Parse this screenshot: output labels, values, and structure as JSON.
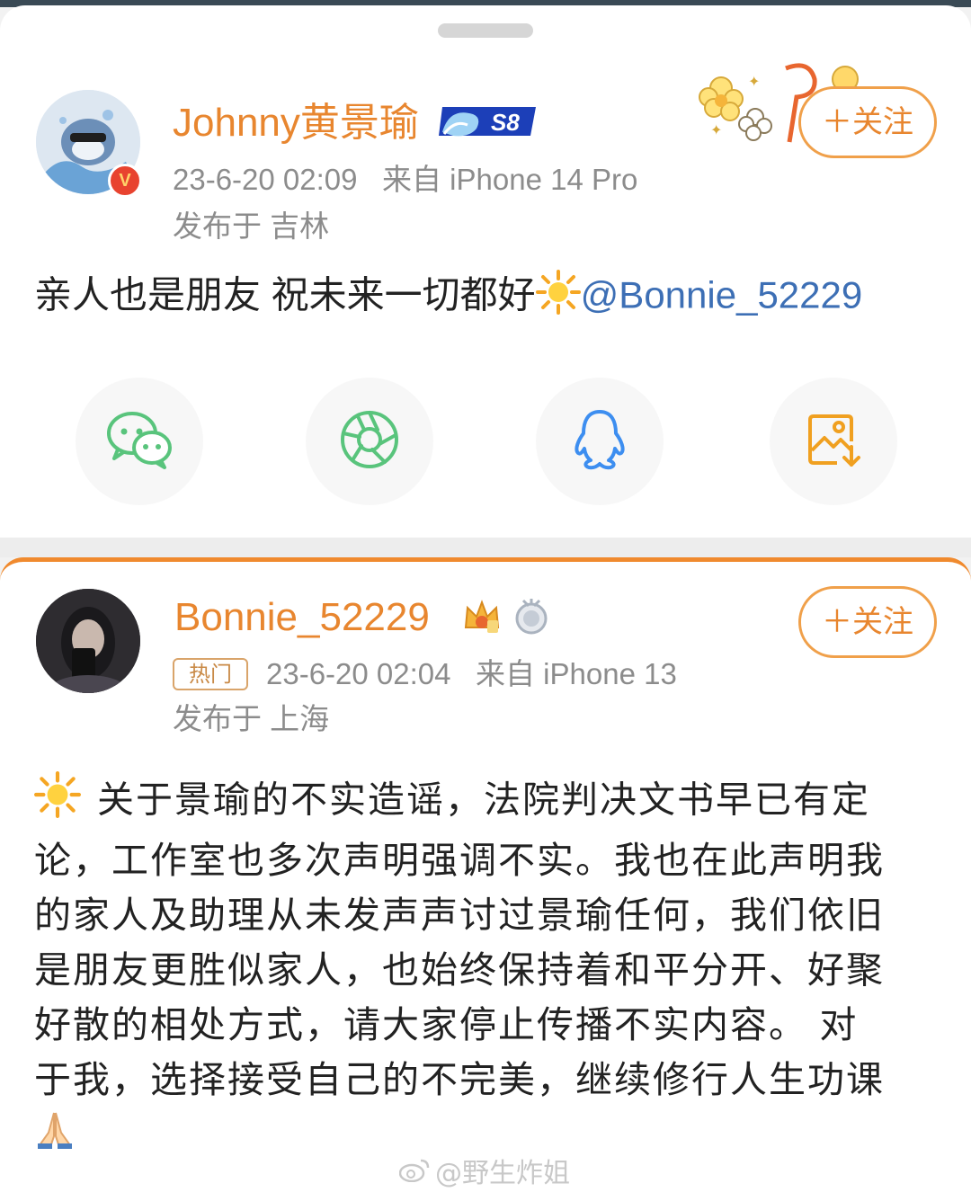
{
  "post1": {
    "username": "Johnny黄景瑜",
    "level_badge": "S8",
    "verified_badge": "V",
    "timestamp": "23-6-20 02:09",
    "source": "来自 iPhone 14 Pro",
    "location": "发布于 吉林",
    "follow_label": "＋关注",
    "text": "亲人也是朋友 祝未来一切都好",
    "mention": "@Bonnie_52229"
  },
  "share_bar": {
    "items": [
      {
        "name": "wechat",
        "icon": "wechat-icon",
        "color": "#59c47c"
      },
      {
        "name": "moments",
        "icon": "moments-aperture-icon",
        "color": "#59c47c"
      },
      {
        "name": "qq",
        "icon": "qq-penguin-icon",
        "color": "#3d8ef0"
      },
      {
        "name": "save-image",
        "icon": "image-download-icon",
        "color": "#f0a020"
      }
    ]
  },
  "post2": {
    "username": "Bonnie_52229",
    "hot_tag": "热门",
    "timestamp": "23-6-20 02:04",
    "source": "来自 iPhone 13",
    "location": "发布于 上海",
    "follow_label": "＋关注",
    "lines": [
      "关于景瑜的不实造谣，法院判决文书早已有定",
      "论，工作室也多次声明强调不实。我也在此声明我",
      "的家人及助理从未发声声讨过景瑜任何，我们依旧",
      "是朋友更胜似家人，也始终保持着和平分开、好聚",
      "好散的相处方式，请大家停止传播不实内容。 对",
      "于我，选择接受自己的不完美，继续修行人生功课"
    ]
  },
  "watermark": "@野生炸姐",
  "colors": {
    "username": "#e8862f",
    "mention": "#3d6fb5",
    "meta": "#8c8c8c",
    "accent_border": "#f08a2e"
  }
}
